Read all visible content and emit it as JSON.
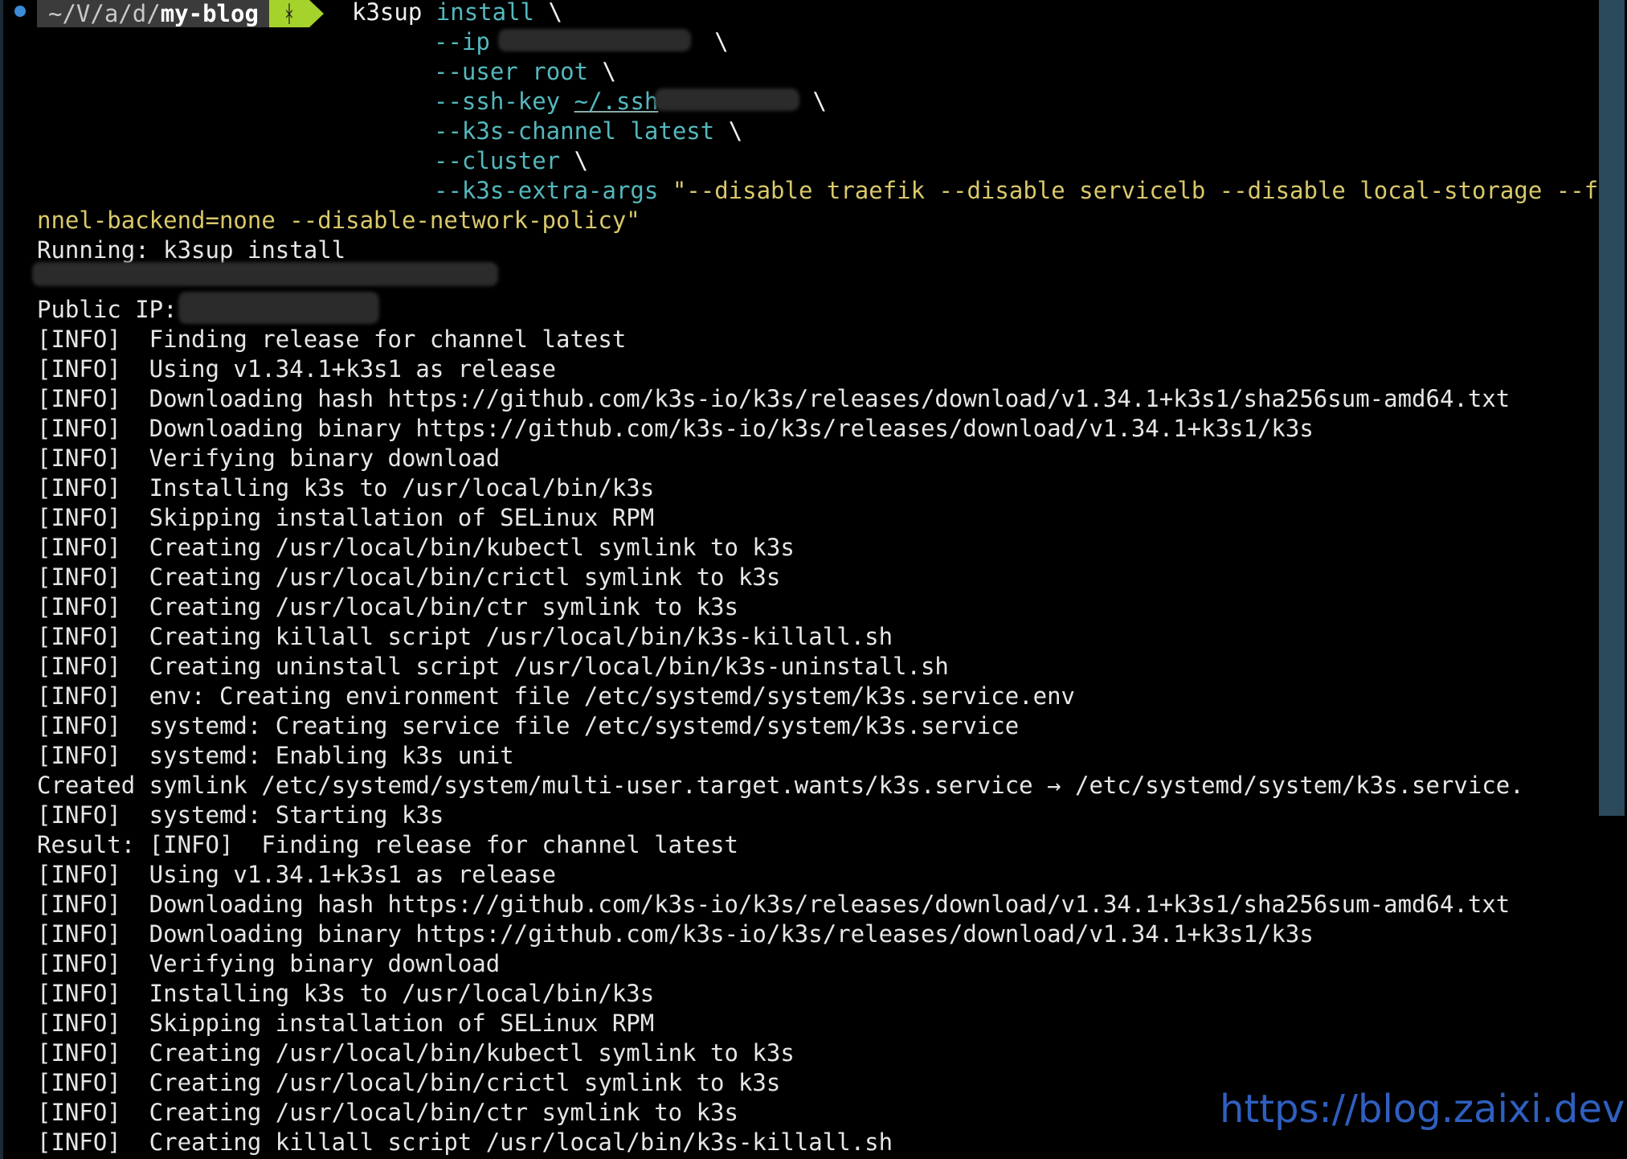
{
  "prompt": {
    "path_prefix": "~/V/a/d/",
    "path_dir": "my-blog",
    "git_icon": "git-branch-icon",
    "git_glyph": "ᚼ"
  },
  "command": {
    "program": "k3sup",
    "subcommand": "install",
    "continuation": "\\",
    "args": {
      "ip_flag": "--ip",
      "user_flag": "--user",
      "user_value": "root",
      "sshkey_flag": "--ssh-key",
      "sshkey_value": "~/.ssh",
      "channel_flag": "--k3s-channel",
      "channel_value": "latest",
      "cluster_flag": "--cluster",
      "extra_flag": "--k3s-extra-args",
      "extra_value_1": "\"--disable traefik --disable servicelb --disable local-storage --fla",
      "extra_value_2": "nnel-backend=none --disable-network-policy\""
    }
  },
  "output": {
    "running": "Running: k3sup install",
    "public_ip": "Public IP:",
    "lines": [
      "[INFO]  Finding release for channel latest",
      "[INFO]  Using v1.34.1+k3s1 as release",
      "[INFO]  Downloading hash https://github.com/k3s-io/k3s/releases/download/v1.34.1+k3s1/sha256sum-amd64.txt",
      "[INFO]  Downloading binary https://github.com/k3s-io/k3s/releases/download/v1.34.1+k3s1/k3s",
      "[INFO]  Verifying binary download",
      "[INFO]  Installing k3s to /usr/local/bin/k3s",
      "[INFO]  Skipping installation of SELinux RPM",
      "[INFO]  Creating /usr/local/bin/kubectl symlink to k3s",
      "[INFO]  Creating /usr/local/bin/crictl symlink to k3s",
      "[INFO]  Creating /usr/local/bin/ctr symlink to k3s",
      "[INFO]  Creating killall script /usr/local/bin/k3s-killall.sh",
      "[INFO]  Creating uninstall script /usr/local/bin/k3s-uninstall.sh",
      "[INFO]  env: Creating environment file /etc/systemd/system/k3s.service.env",
      "[INFO]  systemd: Creating service file /etc/systemd/system/k3s.service",
      "[INFO]  systemd: Enabling k3s unit",
      "Created symlink /etc/systemd/system/multi-user.target.wants/k3s.service → /etc/systemd/system/k3s.service.",
      "[INFO]  systemd: Starting k3s",
      "Result: [INFO]  Finding release for channel latest",
      "[INFO]  Using v1.34.1+k3s1 as release",
      "[INFO]  Downloading hash https://github.com/k3s-io/k3s/releases/download/v1.34.1+k3s1/sha256sum-amd64.txt",
      "[INFO]  Downloading binary https://github.com/k3s-io/k3s/releases/download/v1.34.1+k3s1/k3s",
      "[INFO]  Verifying binary download",
      "[INFO]  Installing k3s to /usr/local/bin/k3s",
      "[INFO]  Skipping installation of SELinux RPM",
      "[INFO]  Creating /usr/local/bin/kubectl symlink to k3s",
      "[INFO]  Creating /usr/local/bin/crictl symlink to k3s",
      "[INFO]  Creating /usr/local/bin/ctr symlink to k3s",
      "[INFO]  Creating killall script /usr/local/bin/k3s-killall.sh"
    ]
  },
  "watermark": "https://blog.zaixi.dev",
  "colors": {
    "background": "#000000",
    "text": "#e6e6e6",
    "flag": "#54b8bd",
    "string": "#d9c96a",
    "git_segment": "#a6d22c",
    "watermark": "#2f5fbf"
  }
}
